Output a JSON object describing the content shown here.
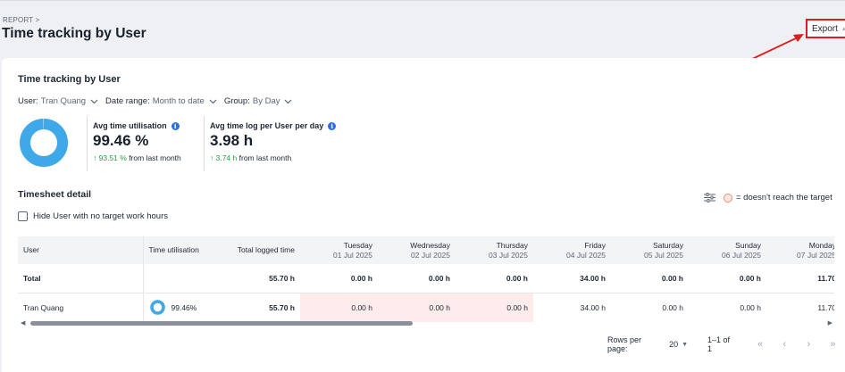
{
  "header": {
    "breadcrumb": "REPORT >",
    "title": "Time tracking by User",
    "export_label": "Export"
  },
  "card": {
    "title": "Time tracking by User",
    "filters": [
      {
        "label": "User:",
        "value": "Tran Quang"
      },
      {
        "label": "Date range:",
        "value": "Month to date"
      },
      {
        "label": "Group:",
        "value": "By Day"
      }
    ]
  },
  "donut": {
    "utilisation_fraction": 0.9946,
    "color": "#3fa8e8"
  },
  "metrics": [
    {
      "label": "Avg time utilisation",
      "value": "99.46 %",
      "trend_value": "↑ 93.51 %",
      "trend_text": "from last month"
    },
    {
      "label": "Avg time log per User per day",
      "value": "3.98 h",
      "trend_value": "↑ 3.74 h",
      "trend_text": "from last month"
    }
  ],
  "timesheet": {
    "title": "Timesheet detail",
    "legend_text": "= doesn't reach the target",
    "hide_label": "Hide User with no target work hours",
    "columns": [
      {
        "name": "User",
        "sub": ""
      },
      {
        "name": "Time utilisation",
        "sub": ""
      },
      {
        "name": "Total logged time",
        "sub": ""
      },
      {
        "name": "Tuesday",
        "sub": "01 Jul 2025"
      },
      {
        "name": "Wednesday",
        "sub": "02 Jul 2025"
      },
      {
        "name": "Thursday",
        "sub": "03 Jul 2025"
      },
      {
        "name": "Friday",
        "sub": "04 Jul 2025"
      },
      {
        "name": "Saturday",
        "sub": "05 Jul 2025"
      },
      {
        "name": "Sunday",
        "sub": "06 Jul 2025"
      },
      {
        "name": "Monday",
        "sub": "07 Jul 2025"
      }
    ],
    "total_row": {
      "label": "Total",
      "total": "55.70 h",
      "days": [
        "0.00 h",
        "0.00 h",
        "0.00 h",
        "34.00 h",
        "0.00 h",
        "0.00 h",
        "11.70"
      ]
    },
    "user_row": {
      "name": "Tran Quang",
      "utilisation": "99.46%",
      "total": "55.70 h",
      "days": [
        "0.00 h",
        "0.00 h",
        "0.00 h",
        "34.00 h",
        "0.00 h",
        "0.00 h",
        "11.70"
      ]
    }
  },
  "pagination": {
    "rows_per_page_label": "Rows per page:",
    "rows_per_page": "20",
    "range": "1–1 of 1"
  },
  "colors": {
    "accent": "#3fa8e8",
    "warn_bg": "#fdeceb",
    "trend_up": "#25a244",
    "annotation": "#e01b1b"
  }
}
